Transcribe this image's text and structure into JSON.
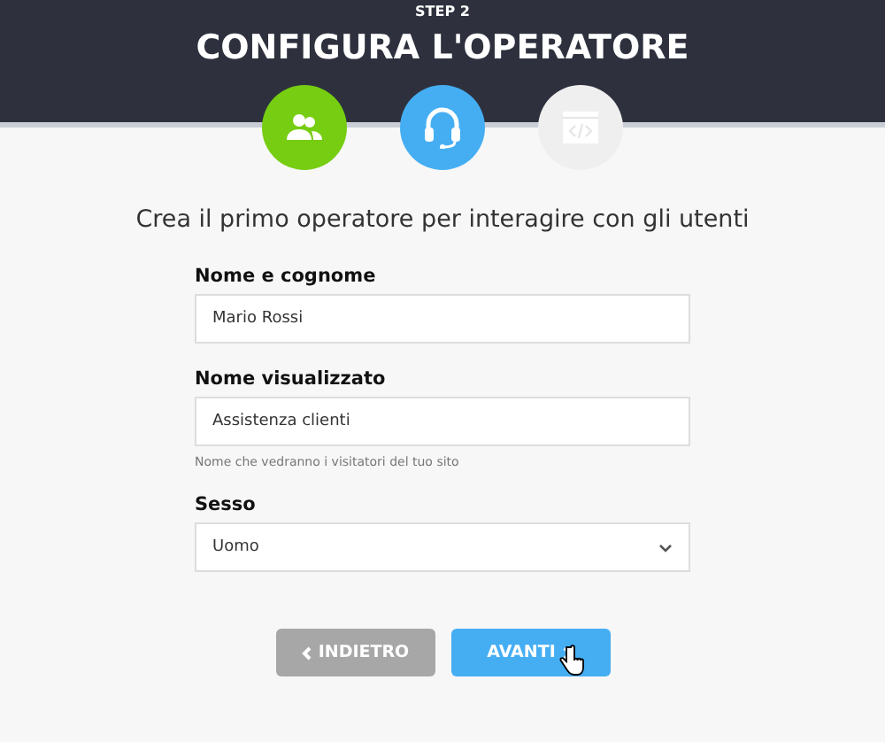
{
  "header": {
    "step": "STEP 2",
    "title": "CONFIGURA L'OPERATORE"
  },
  "steps": [
    {
      "kind": "users",
      "selected": false
    },
    {
      "kind": "headset",
      "selected": true
    },
    {
      "kind": "code",
      "selected": false
    }
  ],
  "subtitle": "Crea il primo operatore per interagire con gli utenti",
  "fields": [
    {
      "kind": "text",
      "label": "Nome e cognome",
      "value": "Mario Rossi"
    },
    {
      "kind": "text",
      "label": "Nome visualizzato",
      "value": "Assistenza clienti",
      "hint": "Nome che vedranno i visitatori del tuo sito"
    },
    {
      "kind": "select",
      "label": "Sesso",
      "value": "Uomo"
    }
  ],
  "buttons": [
    {
      "kind": "back",
      "label": "INDIETRO"
    },
    {
      "kind": "next",
      "label": "AVANTI"
    }
  ]
}
